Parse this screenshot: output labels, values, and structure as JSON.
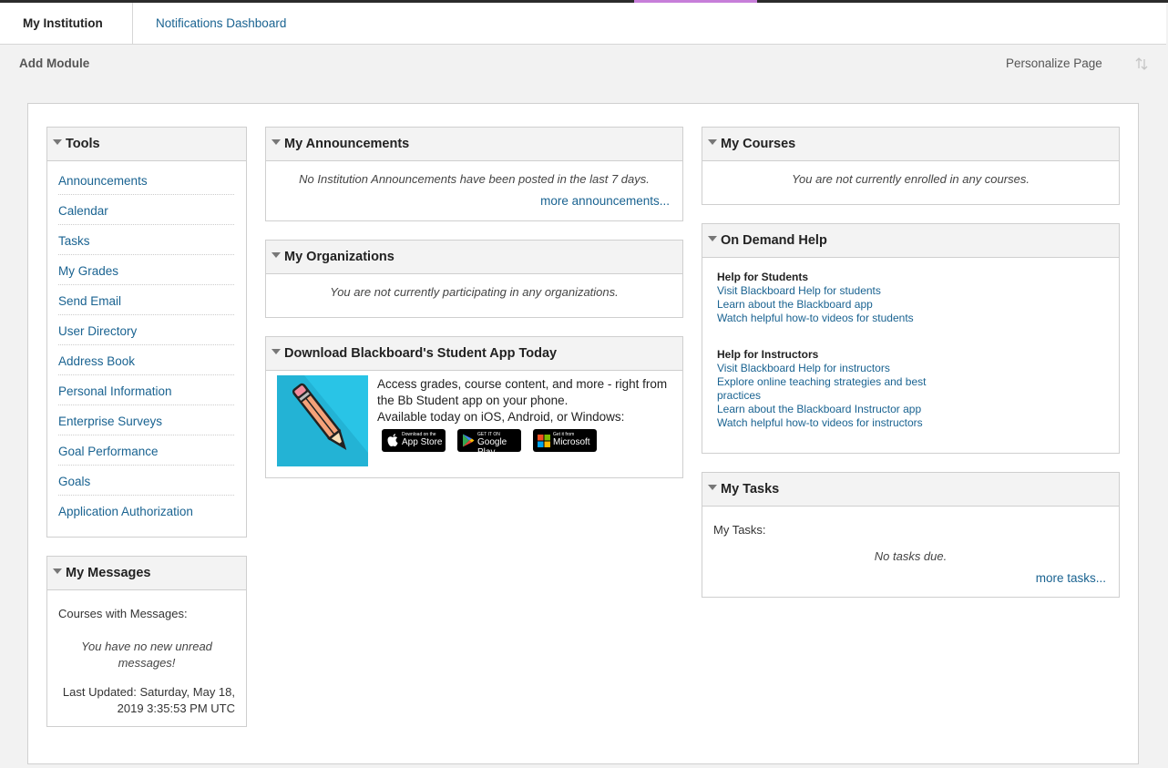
{
  "tabs": {
    "active": "My Institution",
    "other": "Notifications Dashboard"
  },
  "actionbar": {
    "add_module": "Add Module",
    "personalize": "Personalize Page"
  },
  "tools": {
    "title": "Tools",
    "items": [
      "Announcements",
      "Calendar",
      "Tasks",
      "My Grades",
      "Send Email",
      "User Directory",
      "Address Book",
      "Personal Information",
      "Enterprise Surveys",
      "Goal Performance",
      "Goals",
      "Application Authorization"
    ]
  },
  "messages": {
    "title": "My Messages",
    "label": "Courses with Messages:",
    "empty": "You have no new unread messages!",
    "updated_line1": "Last Updated: Saturday, May 18,",
    "updated_line2": "2019 3:35:53 PM UTC"
  },
  "announcements": {
    "title": "My Announcements",
    "empty": "No Institution Announcements have been posted in the last 7 days.",
    "more": "more announcements..."
  },
  "organizations": {
    "title": "My Organizations",
    "empty": "You are not currently participating in any organizations."
  },
  "app": {
    "title": "Download Blackboard's Student App Today",
    "line1": "Access grades, course content, and more - right from",
    "line2": "the Bb Student app on your phone.",
    "line3": "Available today on iOS, Android, or Windows:",
    "appstore_small": "Download on the",
    "appstore_big": "App Store",
    "googleplay_small": "GET IT ON",
    "googleplay_big": "Google Play",
    "microsoft_small": "Get it from",
    "microsoft_big": "Microsoft"
  },
  "courses": {
    "title": "My Courses",
    "empty": "You are not currently enrolled in any courses."
  },
  "help": {
    "title": "On Demand Help",
    "students_head": "Help for Students",
    "students_links": [
      "Visit Blackboard Help for students",
      "Learn about the Blackboard app",
      "Watch helpful how-to videos for students"
    ],
    "instructors_head": "Help for Instructors",
    "instructors_links": [
      "Visit Blackboard Help for instructors",
      "Explore online teaching strategies and best",
      "practices",
      "Learn about the Blackboard Instructor app",
      "Watch helpful how-to videos for instructors"
    ]
  },
  "tasks": {
    "title": "My Tasks",
    "label": "My Tasks:",
    "empty": "No tasks due.",
    "more": "more tasks..."
  },
  "colors": {
    "link": "#1a6391",
    "accent": "#c77ed9",
    "pencil_bg": "#29c4e6",
    "pencil_body": "#f5a279"
  },
  "icons": [
    "collapse-triangle-icon",
    "sort-arrows-icon",
    "pencil-icon",
    "apple-icon",
    "google-play-icon",
    "microsoft-icon"
  ]
}
